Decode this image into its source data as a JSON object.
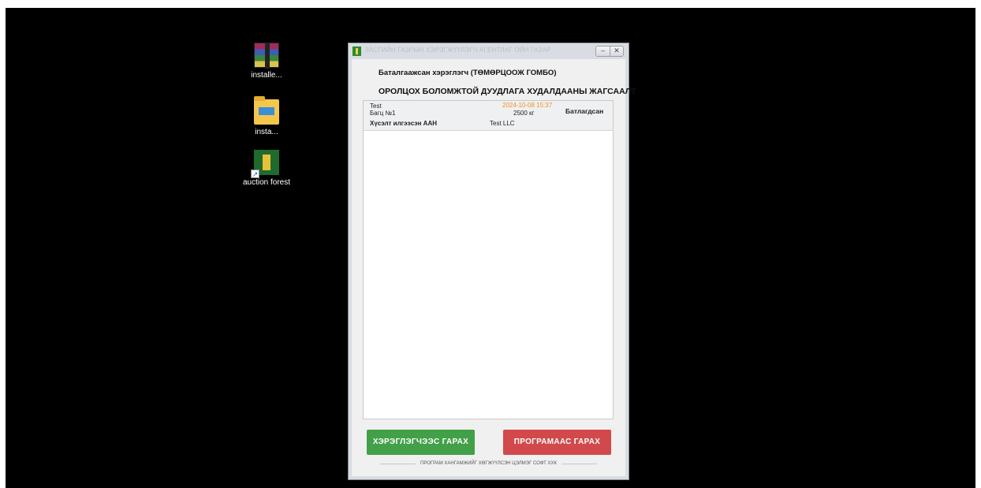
{
  "desktop": {
    "icons": [
      {
        "label": "installe...",
        "icon": "winrar-archive-icon"
      },
      {
        "label": "insta...",
        "icon": "folder-icon"
      },
      {
        "label": "auction forest",
        "icon": "app-shortcut-icon"
      }
    ]
  },
  "window": {
    "title": "ЗАСГИЙН ГАЗРЫН ХЭРЭГЖҮҮЛЭГЧ АГЕНТЛАГ ОЙН ГАЗАР",
    "controls": {
      "minimize": "–",
      "close": "✕"
    },
    "user_line": "Баталгаажсан хэрэглэгч (ТӨМӨРЦООЖ ГОМБО)",
    "list_title": "ОРОЛЦОХ БОЛОМЖТОЙ ДУУДЛАГА ХУДАЛДААНЫ ЖАГСААЛТ",
    "rows": [
      {
        "name": "Test",
        "lot": "Багц №1",
        "requester": "Хүсэлт илгээсэн ААН",
        "date": "2024-10-08 15:37",
        "quantity": "2500 кг",
        "organization": "Test LLC",
        "status": "Батлагдсан"
      }
    ],
    "buttons": {
      "logout": "ХЭРЭГЛЭГЧЭЭС ГАРАХ",
      "exit": "ПРОГРАМААС ГАРАХ"
    },
    "footer": "ПРОГРАМ ХАНГАМЖИЙГ ХӨГЖҮҮЛСЭН ЦЭЛМЭГ СОФТ ХХК"
  },
  "colors": {
    "desktop": "#000000",
    "logout_button": "#41a048",
    "exit_button": "#d2494b",
    "date_text": "#f0921a"
  }
}
